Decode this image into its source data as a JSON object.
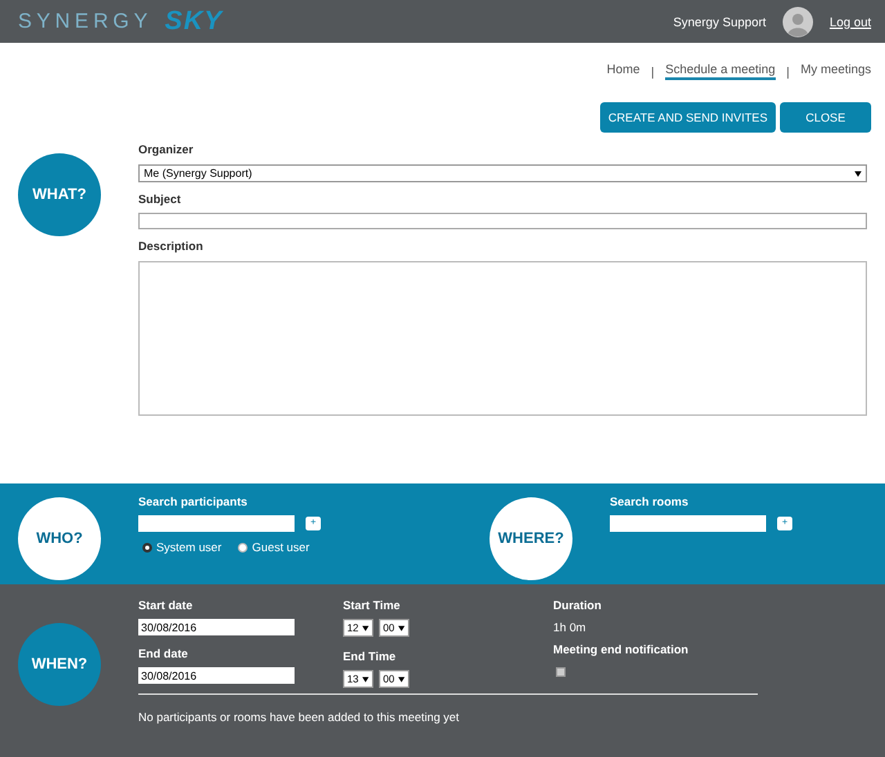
{
  "header": {
    "logo_light": "SYNERGY",
    "logo_bold": "SKY",
    "user_name": "Synergy Support",
    "logout": "Log out"
  },
  "nav": [
    {
      "label": "Home",
      "selected": false
    },
    {
      "label": "Schedule a meeting",
      "selected": true
    },
    {
      "label": "My meetings",
      "selected": false
    }
  ],
  "nav_separator": "|",
  "actions": [
    "CREATE AND SEND INVITES",
    "CLOSE"
  ],
  "what": {
    "badge": "WHAT?",
    "organizer_label": "Organizer",
    "organizer_value": "Me (Synergy Support)",
    "subject_label": "Subject",
    "description_label": "Description"
  },
  "who": {
    "badge": "WHO?",
    "search_label": "Search participants",
    "add": "+",
    "user_types": [
      {
        "label": "System user",
        "selected": true
      },
      {
        "label": "Guest user",
        "selected": false
      }
    ]
  },
  "where": {
    "badge": "WHERE?",
    "search_label": "Search rooms",
    "add": "+"
  },
  "when": {
    "badge": "WHEN?",
    "start_date_label": "Start date",
    "start_date": "30/08/2016",
    "end_date_label": "End date",
    "end_date": "30/08/2016",
    "start_time_label": "Start Time",
    "start_hour": "12",
    "start_minute": "00",
    "end_time_label": "End Time",
    "end_hour": "13",
    "end_minute": "00",
    "duration_label": "Duration",
    "duration": "1h 0m",
    "notification_label": "Meeting end notification",
    "notification_checked": false,
    "message": "No participants or rooms have been added to this meeting yet"
  }
}
